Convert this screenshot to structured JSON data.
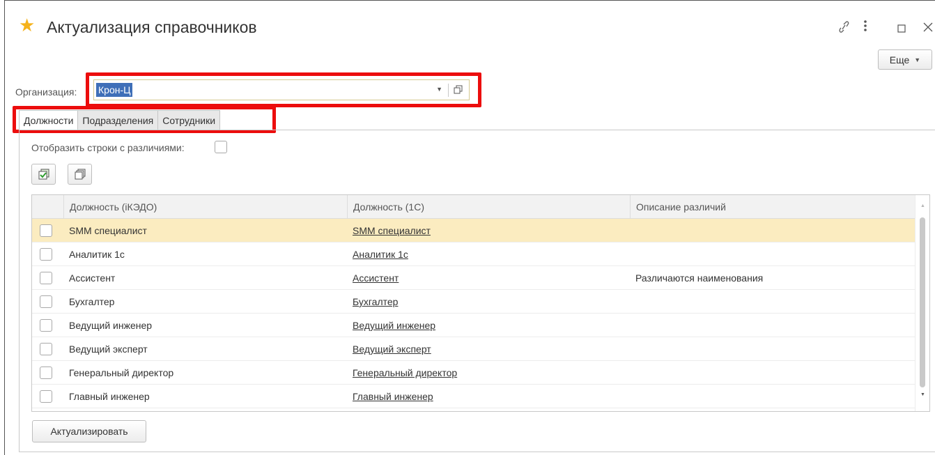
{
  "window": {
    "title": "Актуализация справочников",
    "star_color": "#f5b21b",
    "controls": {
      "link_icon": "link-icon",
      "menu_icon": "more-vert-icon",
      "maximize_icon": "maximize-icon",
      "close_icon": "close-icon"
    }
  },
  "toolbar": {
    "more_label": "Еще"
  },
  "organization": {
    "label": "Организация:",
    "value": "Крон-Ц"
  },
  "tabs": [
    {
      "label": "Должности",
      "active": true
    },
    {
      "label": "Подразделения",
      "active": false
    },
    {
      "label": "Сотрудники",
      "active": false
    }
  ],
  "filter": {
    "show_differences_label": "Отобразить строки с различиями:",
    "checked": false
  },
  "table": {
    "columns": [
      "Должность (iКЭДО)",
      "Должность (1С)",
      "Описание различий"
    ],
    "rows": [
      {
        "ikedo": "SMM специалист",
        "onec": "SMM специалист",
        "diff": "",
        "selected": true
      },
      {
        "ikedo": "Аналитик 1с",
        "onec": "Аналитик 1с",
        "diff": ""
      },
      {
        "ikedo": "Ассистент",
        "onec": "Ассистент",
        "diff": "Различаются наименования"
      },
      {
        "ikedo": "Бухгалтер",
        "onec": "Бухгалтер",
        "diff": ""
      },
      {
        "ikedo": "Ведущий инженер",
        "onec": "Ведущий инженер",
        "diff": ""
      },
      {
        "ikedo": "Ведущий эксперт",
        "onec": "Ведущий эксперт",
        "diff": ""
      },
      {
        "ikedo": "Генеральный директор",
        "onec": "Генеральный директор",
        "diff": ""
      },
      {
        "ikedo": "Главный инженер",
        "onec": "Главный инженер",
        "diff": ""
      }
    ]
  },
  "actions": {
    "actualize_label": "Актуализировать"
  },
  "colors": {
    "highlight": "#ec0d0d",
    "selected_row": "#fbecc0",
    "selection": "#3f6fb8"
  }
}
